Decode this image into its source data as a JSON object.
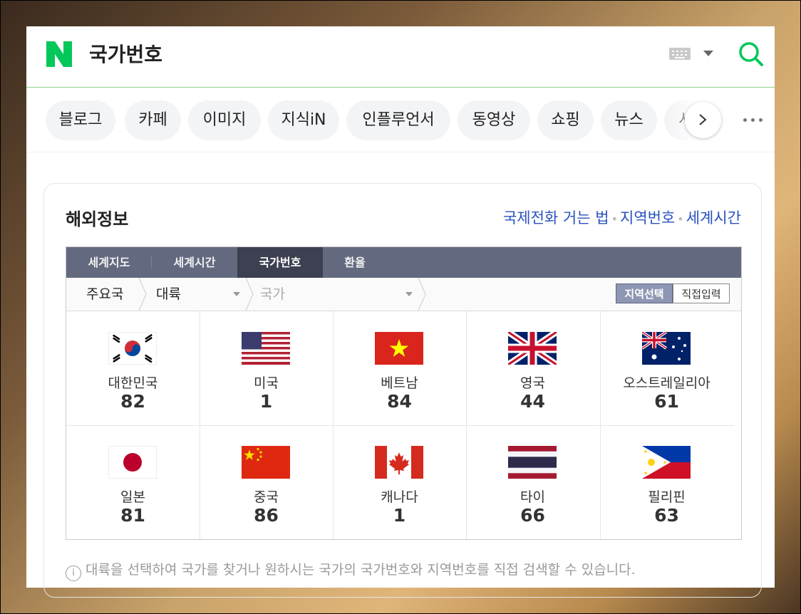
{
  "search": {
    "query": "국가번호",
    "logo_letter": "N",
    "brand_color": "#03c75a"
  },
  "tabs": [
    {
      "label": "블로그"
    },
    {
      "label": "카페"
    },
    {
      "label": "이미지"
    },
    {
      "label": "지식iN"
    },
    {
      "label": "인플루언서"
    },
    {
      "label": "동영상"
    },
    {
      "label": "쇼핑"
    },
    {
      "label": "뉴스"
    },
    {
      "label": "서"
    }
  ],
  "card": {
    "title": "해외정보",
    "links": [
      "국제전화 거는 법",
      "지역번호",
      "세계시간"
    ]
  },
  "widget": {
    "tabs": [
      {
        "label": "세계지도",
        "active": false
      },
      {
        "label": "세계시간",
        "active": false
      },
      {
        "label": "국가번호",
        "active": true
      },
      {
        "label": "환율",
        "active": false
      }
    ],
    "filter": {
      "root": "주요국",
      "continent": "대륙",
      "country_placeholder": "국가",
      "mode_select": "지역선택",
      "mode_input": "직접입력"
    },
    "countries": [
      {
        "name": "대한민국",
        "code": "82",
        "flag": "kr-flag"
      },
      {
        "name": "미국",
        "code": "1",
        "flag": "us-flag"
      },
      {
        "name": "베트남",
        "code": "84",
        "flag": "vn-flag"
      },
      {
        "name": "영국",
        "code": "44",
        "flag": "uk-flag"
      },
      {
        "name": "오스트레일리아",
        "code": "61",
        "flag": "au-flag"
      },
      {
        "name": "일본",
        "code": "81",
        "flag": "jp-flag"
      },
      {
        "name": "중국",
        "code": "86",
        "flag": "cn-flag"
      },
      {
        "name": "캐나다",
        "code": "1",
        "flag": "ca-flag"
      },
      {
        "name": "타이",
        "code": "66",
        "flag": "th-flag"
      },
      {
        "name": "필리핀",
        "code": "63",
        "flag": "ph-flag"
      }
    ]
  },
  "info": {
    "text": "대륙을 선택하여 국가를 찾거나 원하시는 국가의 국가번호와 지역번호를 직접 검색할 수 있습니다."
  }
}
